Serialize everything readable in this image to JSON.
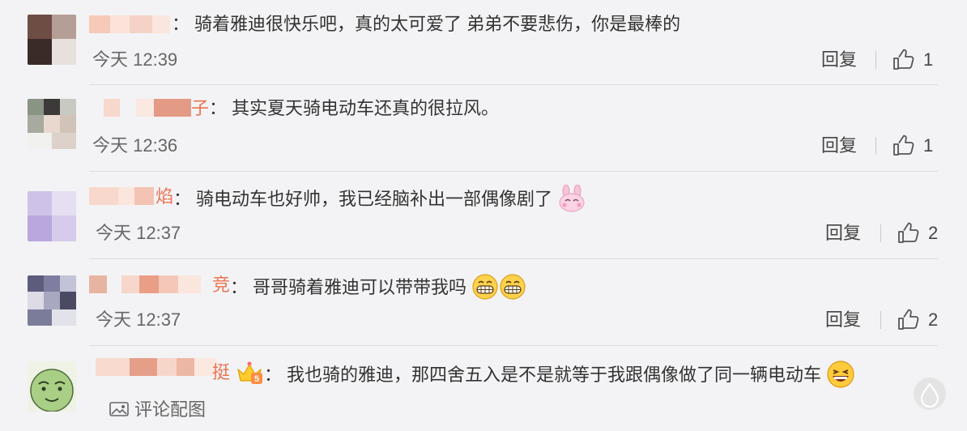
{
  "comments": [
    {
      "name_visible": "",
      "text": "骑着雅迪很快乐吧，真的太可爱了 弟弟不要悲伤，你是最棒的",
      "time": "今天 12:39",
      "reply": "回复",
      "likes": "1"
    },
    {
      "name_visible": "子",
      "text": "其实夏天骑电动车还真的很拉风。",
      "time": "今天 12:36",
      "reply": "回复",
      "likes": "1"
    },
    {
      "name_visible": "焰",
      "text": "骑电动车也好帅，我已经脑补出一部偶像剧了",
      "time": "今天 12:37",
      "reply": "回复",
      "likes": "2"
    },
    {
      "name_visible": "竞",
      "text": "哥哥骑着雅迪可以带带我吗",
      "time": "今天 12:37",
      "reply": "回复",
      "likes": "2"
    },
    {
      "name_visible": "挺",
      "text": "我也骑的雅迪，那四舍五入是不是就等于我跟偶像做了同一辆电动车",
      "time": "",
      "reply": "",
      "likes": ""
    }
  ],
  "composer": {
    "label": "评论配图"
  },
  "colors": {
    "background": "#f3f3f5",
    "name": "#eb7350",
    "text": "#333333",
    "meta": "#666666",
    "divider": "#dcdcdc"
  }
}
